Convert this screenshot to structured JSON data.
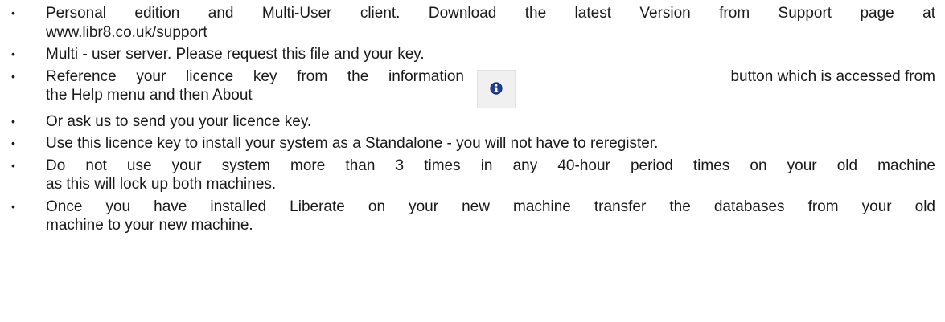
{
  "bullet_symbol": "•",
  "items": [
    {
      "line1": "Personal edition and Multi-User client. Download the latest Version from Support page at",
      "line2": "www.libr8.co.uk/support"
    },
    {
      "line1": "Multi - user server. Please request this file and your key."
    },
    {
      "line1_left": "Reference your licence key from the information",
      "line1_right": "button which is accessed from",
      "line2": "the Help menu and then About",
      "icon": "info-icon"
    },
    {
      "line1": "Or ask us to send you your licence key."
    },
    {
      "line1": "Use this licence key to install your system as a Standalone - you will not have to reregister."
    },
    {
      "line1": "Do not use your system more than 3 times in any 40-hour period times on your old machine",
      "line2": "as this will lock up both machines."
    },
    {
      "line1": "Once you have installed Liberate on your new machine transfer the databases from your old",
      "line2": "machine to your new machine."
    }
  ],
  "colors": {
    "text": "#1a1a1a",
    "icon_blue": "#1f3f8f",
    "button_bg": "#f0f0f0"
  }
}
